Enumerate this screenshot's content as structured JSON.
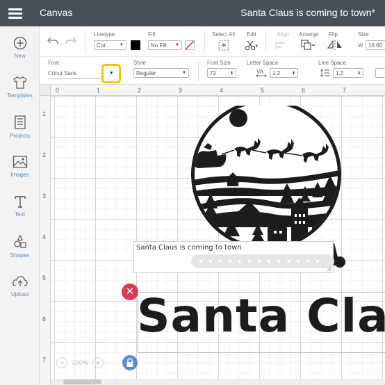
{
  "header": {
    "app_title": "Canvas",
    "project_title": "Santa Claus is coming to town*"
  },
  "sidebar": {
    "items": [
      {
        "label": "New",
        "icon": "plus-circle-icon"
      },
      {
        "label": "Templates",
        "icon": "shirt-icon"
      },
      {
        "label": "Projects",
        "icon": "projects-icon"
      },
      {
        "label": "Images",
        "icon": "image-icon"
      },
      {
        "label": "Text",
        "icon": "text-icon"
      },
      {
        "label": "Shapes",
        "icon": "shapes-icon"
      },
      {
        "label": "Upload",
        "icon": "upload-cloud-icon"
      }
    ]
  },
  "toolbar": {
    "linetype_label": "Linetype",
    "linetype_value": "Cut",
    "fill_label": "Fill",
    "fill_value": "No Fill",
    "select_all_label": "Select All",
    "edit_label": "Edit",
    "align_label": "Align",
    "arrange_label": "Arrange",
    "flip_label": "Flip",
    "size_label": "Size",
    "size_w_label": "W",
    "size_w_value": "16.60",
    "linetype_color": "#000000"
  },
  "text_toolbar": {
    "font_label": "Font",
    "font_value": "Cricut Sans",
    "style_label": "Style",
    "style_value": "Regular",
    "font_size_label": "Font Size",
    "font_size_value": "72",
    "letter_space_label": "Letter Space",
    "letter_space_value": "1.2",
    "line_space_label": "Line Space",
    "line_space_value": "1.2",
    "highlight_color": "#f7c600"
  },
  "ruler": {
    "top": [
      "0",
      "1",
      "2",
      "3",
      "4",
      "5",
      "6",
      "7"
    ],
    "left": [
      "1",
      "2",
      "3",
      "4",
      "5",
      "6",
      "7"
    ]
  },
  "canvas": {
    "textbox_value": "Santa Claus is coming to town",
    "big_text": "Santa Claus",
    "zoom": "100%",
    "delete_color": "#d83b53",
    "lock_color": "#5d8bd1"
  }
}
